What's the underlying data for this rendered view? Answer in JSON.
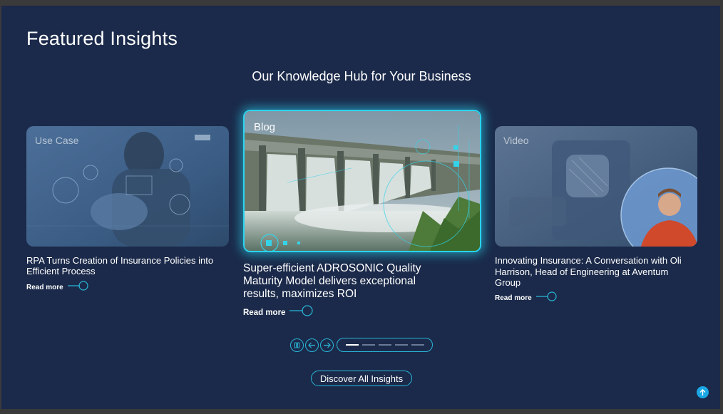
{
  "section": {
    "title": "Featured Insights",
    "subtitle": "Our Knowledge Hub for Your Business"
  },
  "cards": [
    {
      "tag": "Use Case",
      "title": "RPA Turns Creation of Insurance Policies into Efficient Process",
      "read_more": "Read more",
      "image": "robotic-hand-ui-illustration"
    },
    {
      "tag": "Blog",
      "title": "Super-efficient ADROSONIC Quality Maturity Model delivers exceptional results, maximizes ROI",
      "read_more": "Read more",
      "image": "dam-spillway-photo"
    },
    {
      "tag": "Video",
      "title": "Innovating Insurance: A Conversation with Oli Harrison, Head of Engineering at Aventum Group",
      "read_more": "Read more",
      "image": "podcast-microphone-with-speaker-portrait"
    }
  ],
  "carousel": {
    "pause_icon": "pause-icon",
    "prev_icon": "arrow-left-icon",
    "next_icon": "arrow-right-icon",
    "slide_count": 5,
    "active_slide": 1
  },
  "cta": {
    "discover_label": "Discover All Insights"
  },
  "colors": {
    "background": "#1b2a4a",
    "accent": "#29b6d8",
    "glow": "#2ad4ef",
    "back_to_top": "#1aa7e4"
  },
  "back_to_top_icon": "arrow-up-icon"
}
